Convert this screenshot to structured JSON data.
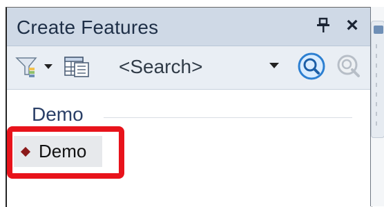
{
  "panel": {
    "title": "Create Features",
    "search_placeholder": "<Search>",
    "group_header": "Demo",
    "template_label": "Demo"
  },
  "icons": {
    "filter": "filter-icon",
    "table": "table-icon",
    "search": "search-icon",
    "clear_search": "clear-search-icon",
    "pin": "pin-icon",
    "close": "close-icon",
    "template_symbol": "point-symbol-icon"
  },
  "colors": {
    "titlebar_bg": "#cfd9e6",
    "toolbar_bg": "#e9eef4",
    "highlight_red": "#e8131b",
    "group_text": "#2a3f67",
    "template_symbol": "#8b1a1a"
  }
}
